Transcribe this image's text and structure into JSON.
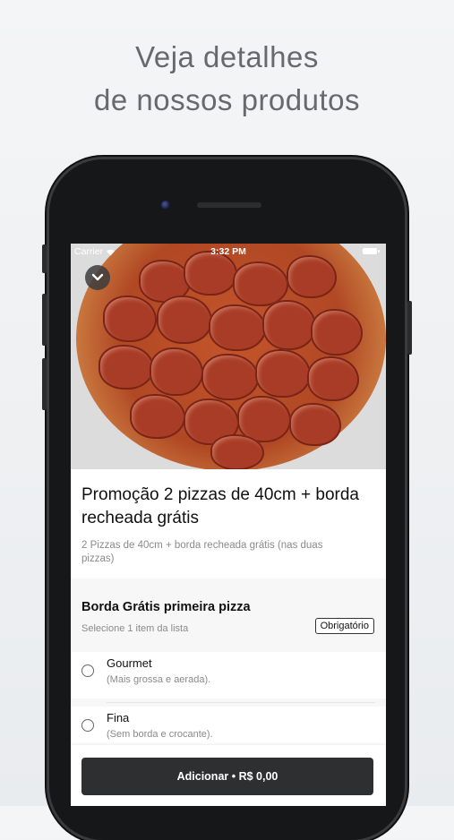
{
  "headline": {
    "line1": "Veja detalhes",
    "line2": "de nossos produtos"
  },
  "status_bar": {
    "carrier": "Carrier",
    "time": "3:32 PM"
  },
  "product": {
    "title": "Promoção 2 pizzas de 40cm + borda recheada grátis",
    "description": "2 Pizzas de 40cm + borda recheada grátis (nas duas pizzas)"
  },
  "option_group": {
    "title": "Borda Grátis primeira pizza",
    "subtitle": "Selecione 1 item da lista",
    "badge": "Obrigatório",
    "options": [
      {
        "name": "Gourmet",
        "description": "(Mais grossa e aerada)."
      },
      {
        "name": "Fina",
        "description": "(Sem borda e crocante)."
      }
    ]
  },
  "footer": {
    "add_button": "Adicionar • R$ 0,00"
  }
}
